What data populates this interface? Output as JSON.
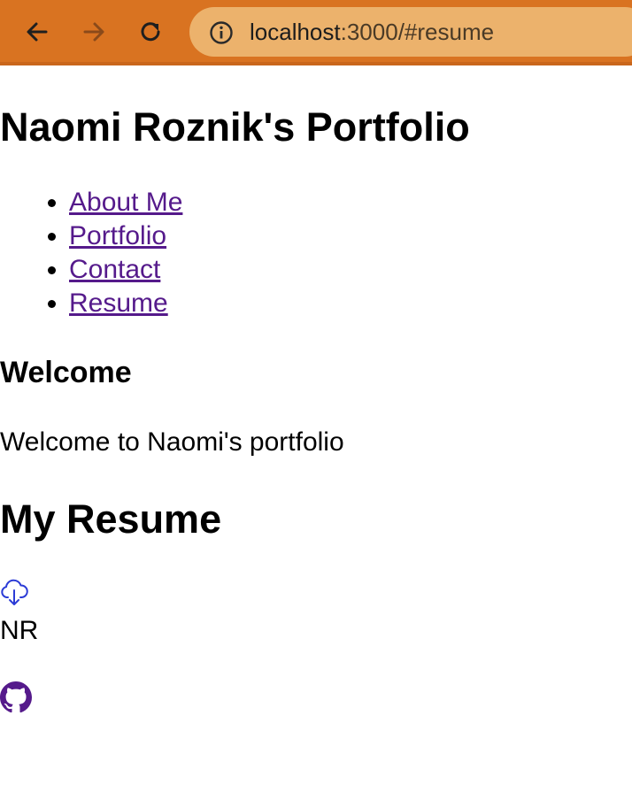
{
  "browser": {
    "url_host": "localhost",
    "url_path": ":3000/#resume",
    "toolbar_color": "#d97321",
    "omnibox_color": "#ecb26c"
  },
  "page": {
    "title": "Naomi Roznik's Portfolio",
    "nav": [
      {
        "label": "About Me"
      },
      {
        "label": "Portfolio"
      },
      {
        "label": "Contact"
      },
      {
        "label": "Resume"
      }
    ],
    "link_color": "#551a8b",
    "welcome_heading": "Welcome",
    "welcome_text": "Welcome to Naomi's portfolio",
    "resume_heading": "My Resume",
    "initials": "NR",
    "icons": [
      "arrow-left-icon",
      "arrow-right-icon",
      "reload-icon",
      "info-icon",
      "cloud-download-icon",
      "github-icon"
    ]
  }
}
